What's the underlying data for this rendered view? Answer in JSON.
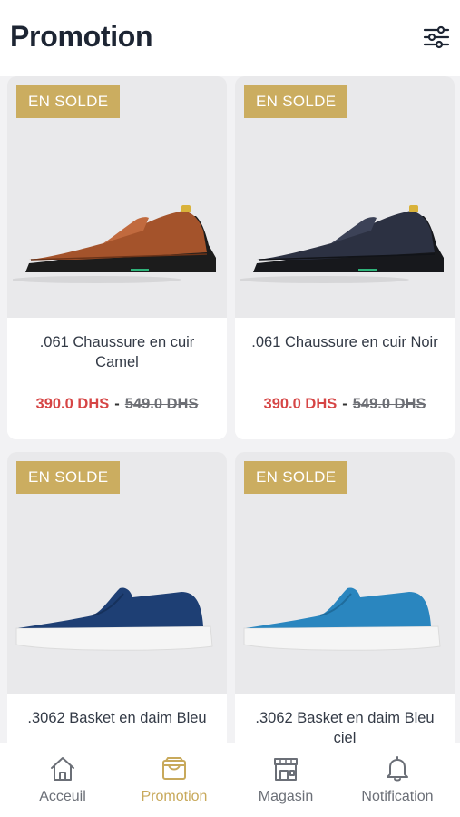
{
  "header": {
    "title": "Promotion",
    "filter_icon": "sliders-icon"
  },
  "products": [
    {
      "badge": "EN SOLDE",
      "name": ".061 Chaussure en cuir Camel",
      "price": "390.0 DHS",
      "old_price": "549.0 DHS",
      "shoe_color": "#a4532b",
      "sole_color": "#1c1c1c",
      "style": "loafer"
    },
    {
      "badge": "EN SOLDE",
      "name": ".061 Chaussure en cuir Noir",
      "price": "390.0 DHS",
      "old_price": "549.0 DHS",
      "shoe_color": "#2c3142",
      "sole_color": "#17181c",
      "style": "loafer"
    },
    {
      "badge": "EN SOLDE",
      "name": ".3062 Basket en daim Bleu",
      "price": "",
      "old_price": "",
      "shoe_color": "#1e3f74",
      "sole_color": "#f3f3f3",
      "style": "sneaker"
    },
    {
      "badge": "EN SOLDE",
      "name": ".3062 Basket en daim Bleu ciel",
      "price": "",
      "old_price": "",
      "shoe_color": "#2a86bf",
      "sole_color": "#f3f3f3",
      "style": "sneaker"
    }
  ],
  "price_separator": "-",
  "tabs": [
    {
      "label": "Acceuil",
      "icon": "home-icon",
      "active": false
    },
    {
      "label": "Promotion",
      "icon": "wallet-icon",
      "active": true
    },
    {
      "label": "Magasin",
      "icon": "store-icon",
      "active": false
    },
    {
      "label": "Notification",
      "icon": "bell-icon",
      "active": false
    }
  ],
  "colors": {
    "accent": "#c8a95b",
    "badge": "#cbad60",
    "sale_price": "#d64545"
  }
}
